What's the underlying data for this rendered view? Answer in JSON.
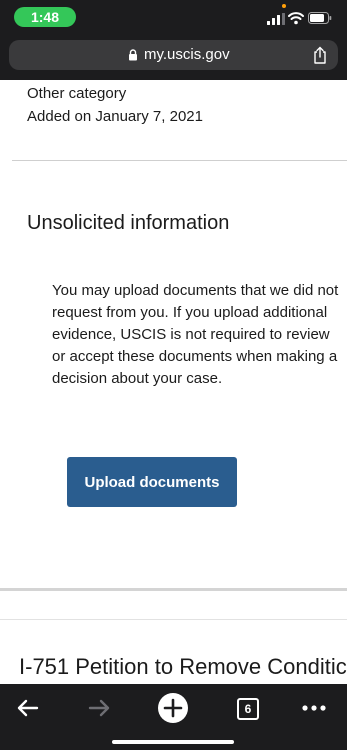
{
  "status_bar": {
    "time": "1:48"
  },
  "browser": {
    "url": "my.uscis.gov",
    "tabs_count": "6"
  },
  "page": {
    "category_line": "Other category",
    "added_line": "Added on January 7, 2021",
    "section": {
      "heading": "Unsolicited information",
      "body": "You may upload documents that we did not request from you. If you upload additional evidence, USCIS is not required to review or accept these documents when making a decision about your case.",
      "button_label": "Upload documents"
    },
    "next_card_heading": "I-751 Petition to Remove Conditic"
  },
  "colors": {
    "button": "#2a5d8f",
    "time_pill": "#34c759",
    "chrome": "#1c1c1e"
  }
}
